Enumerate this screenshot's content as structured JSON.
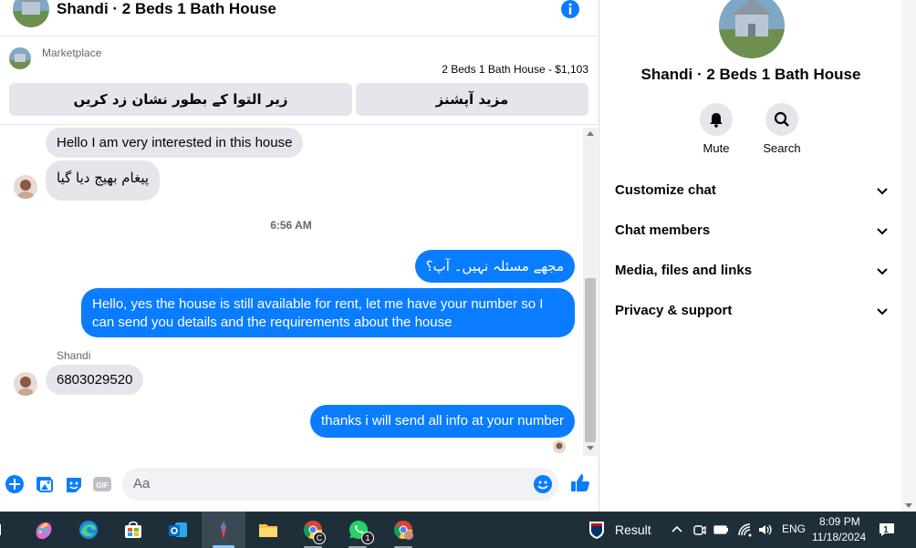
{
  "header": {
    "title": "Shandi · 2 Beds 1 Bath House"
  },
  "marketplace": {
    "label": "Marketplace",
    "listing": "2 Beds 1 Bath House - $1,103",
    "btn_left": "زیر التوا کے بطور نشان زد کریں",
    "btn_right": "مزید آپشنز"
  },
  "messages": {
    "in_1": "Hello I am very interested in this house",
    "in_2": "پیغام بھیج دیا گیا",
    "time": "6:56 AM",
    "out_1": "مجھے مسئلہ نہیں۔ آپ؟",
    "out_2": "Hello, yes the house is still available for rent, let me have your number so I can send you details and the requirements about the house",
    "sender": "Shandi",
    "in_3": "6803029520",
    "out_3": "thanks i will send all info at your number"
  },
  "composer": {
    "placeholder": "Aa"
  },
  "details": {
    "title": "Shandi · 2 Beds 1 Bath House",
    "mute": "Mute",
    "search": "Search",
    "sections": [
      "Customize chat",
      "Chat members",
      "Media, files and links",
      "Privacy & support"
    ]
  },
  "taskbar": {
    "weather": "Result",
    "lang": "ENG",
    "time": "8:09 PM",
    "date": "11/18/2024",
    "notif_count": "1",
    "whatsapp_badge": "1",
    "chrome_badge": "C"
  },
  "colors": {
    "accent": "#0a7cff",
    "incoming": "#e4e6eb",
    "taskbar": "#1f2f3a"
  }
}
